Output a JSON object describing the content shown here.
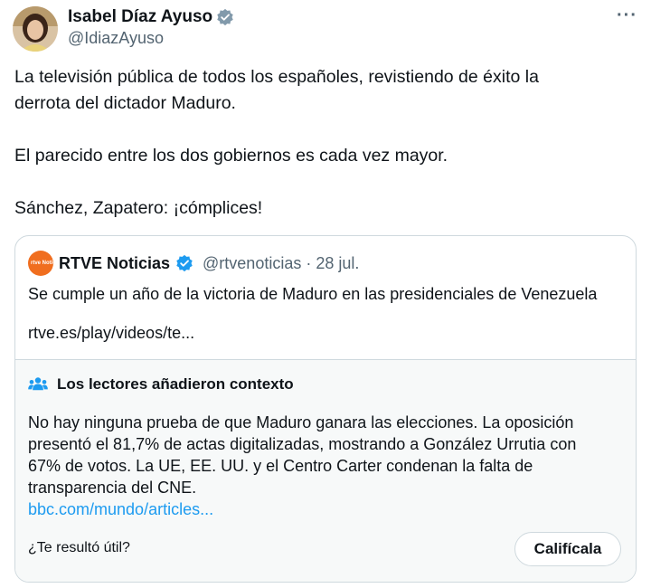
{
  "tweet": {
    "author_name": "Isabel Díaz Ayuso",
    "author_handle": "@IdiazAyuso",
    "more_label": "···",
    "text_lines": [
      "La televisión pública de todos los españoles, revistiendo de éxito la",
      "derrota del dictador Maduro.",
      "El parecido entre los dos gobiernos es cada vez mayor.",
      "Sánchez, Zapatero: ¡cómplices!"
    ]
  },
  "quote": {
    "logo_text": "rtve Noticias",
    "author_name": "RTVE Noticias",
    "author_handle_date": "@rtvenoticias · 28 jul.",
    "text": "Se cumple un año de la victoria de Maduro en las presidenciales de Venezuela",
    "link": "rtve.es/play/videos/te..."
  },
  "community_note": {
    "title": "Los lectores añadieron contexto",
    "body_lines": [
      "No hay ninguna prueba de que Maduro ganara las elecciones. La oposición",
      "presentó el 81,7% de actas digitalizadas, mostrando a González Urrutia con",
      "67% de votos. La UE, EE. UU. y el Centro Carter condenan la falta de",
      "transparencia del CNE."
    ],
    "link": "bbc.com/mundo/articles...",
    "question": "¿Te resultó útil?",
    "rate_button": "Califícala"
  },
  "colors": {
    "link_blue": "#1d9bf0",
    "verified_blue": "#1d9bf0",
    "verified_gray": "#829aab",
    "rtve_orange": "#f06e1f",
    "muted_text": "#536471"
  },
  "icons": [
    "verified-gray-badge",
    "verified-blue-badge",
    "more-dots-icon",
    "community-notes-icon",
    "rtve-logo"
  ]
}
